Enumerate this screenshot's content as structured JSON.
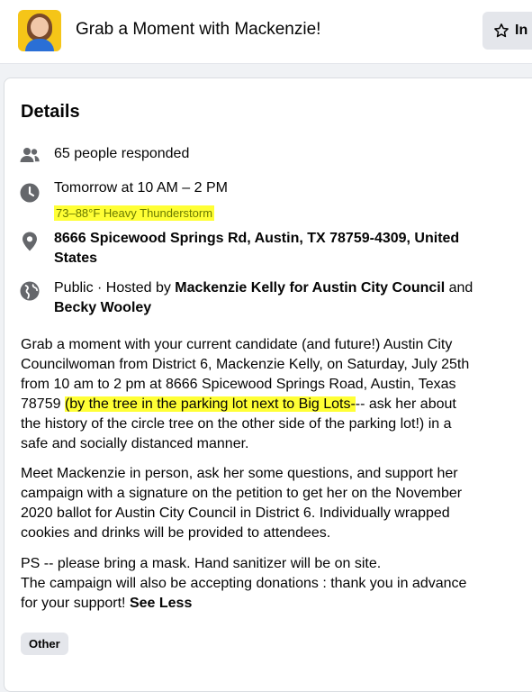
{
  "header": {
    "title": "Grab a Moment with Mackenzie!",
    "interested_label": "In"
  },
  "details": {
    "heading": "Details",
    "responded": "65 people responded",
    "time": "Tomorrow at 10 AM – 2 PM",
    "weather": "73–88°F Heavy Thunderstorm",
    "address_line1": "8666 Spicewood Springs Rd, Austin, TX 78759-4309, United",
    "address_line2": "States",
    "visibility_prefix": "Public · Hosted by ",
    "host1": "Mackenzie Kelly for Austin City Council",
    "and": " and",
    "host2": "Becky Wooley"
  },
  "description": {
    "p1_lines": [
      "Grab a moment with your current candidate (and future!) Austin City",
      "Councilwoman from District 6, Mackenzie Kelly, on Saturday, July 25th",
      "from 10 am to 2 pm at 8666 Spicewood Springs Road, Austin, Texas"
    ],
    "p1_line4_prefix": "78759 ",
    "p1_line4_highlight": "(by the tree in the parking lot next to Big Lots-",
    "p1_line4_suffix": "-- ask her about",
    "p1_line5": "the history of the circle tree on the other side of the parking lot!) in a",
    "p1_line6": "safe and socially distanced manner.",
    "p2_lines": [
      "Meet Mackenzie in person, ask her some questions, and support her",
      "campaign with a signature on the petition to get her on the November",
      "2020 ballot for Austin City Council in District 6. Individually wrapped",
      "cookies and drinks will be provided to attendees."
    ],
    "p3_line1": "PS -- please bring a mask. Hand sanitizer will be on site.",
    "p3_line2": "The campaign will also be accepting donations : thank you in advance",
    "p3_line3": "for your support! ",
    "see_less": "See Less"
  },
  "tag": "Other",
  "icons": {
    "people": "people-icon",
    "clock": "clock-icon",
    "location": "location-pin-icon",
    "globe": "globe-icon",
    "star": "star-icon"
  }
}
